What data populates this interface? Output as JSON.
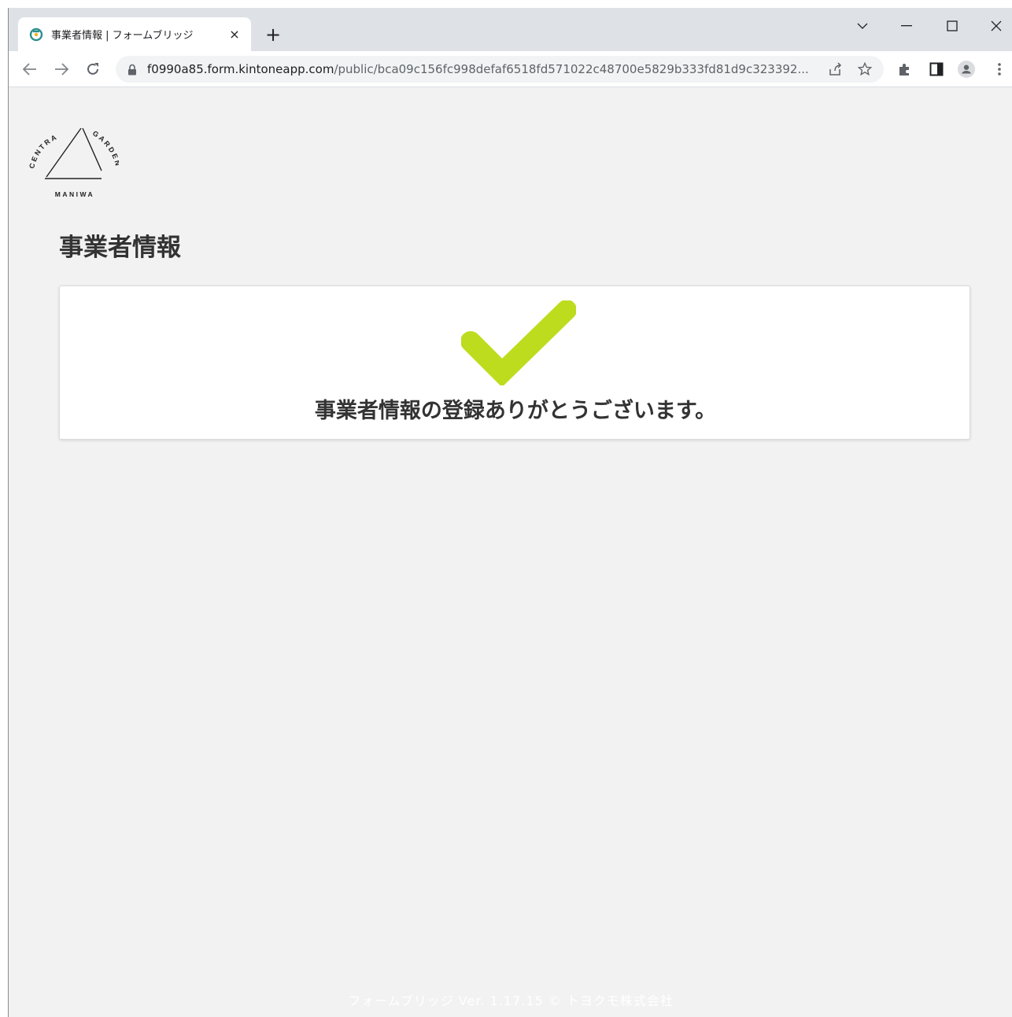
{
  "browser": {
    "tab_title": "事業者情報 | フォームブリッジ",
    "tab_close": "×",
    "new_tab": "+",
    "url_host": "f0990a85.form.kintoneapp.com",
    "url_path": "/public/bca09c156fc998defaf6518fd571022c48700e5829b333fd81d9c323392..."
  },
  "logo": {
    "text_arc_left": "CENTRAL",
    "text_arc_right": "GARDEN",
    "text_bottom": "MANIWA"
  },
  "page": {
    "title": "事業者情報",
    "message": "事業者情報の登録ありがとうございます。",
    "footer": "フォームブリッジ Ver. 1.17.15 © トヨクモ株式会社"
  },
  "colors": {
    "accent_check": "#bedc1e",
    "background": "#f2f2f2",
    "tab_strip": "#dee1e6"
  },
  "icons": [
    "kintone-favicon",
    "back-arrow-icon",
    "forward-arrow-icon",
    "reload-icon",
    "lock-icon",
    "share-icon",
    "star-icon",
    "extensions-icon",
    "side-panel-icon",
    "profile-icon",
    "menu-icon",
    "chevron-down-icon",
    "minimize-icon",
    "maximize-icon",
    "close-icon",
    "checkmark-icon"
  ]
}
